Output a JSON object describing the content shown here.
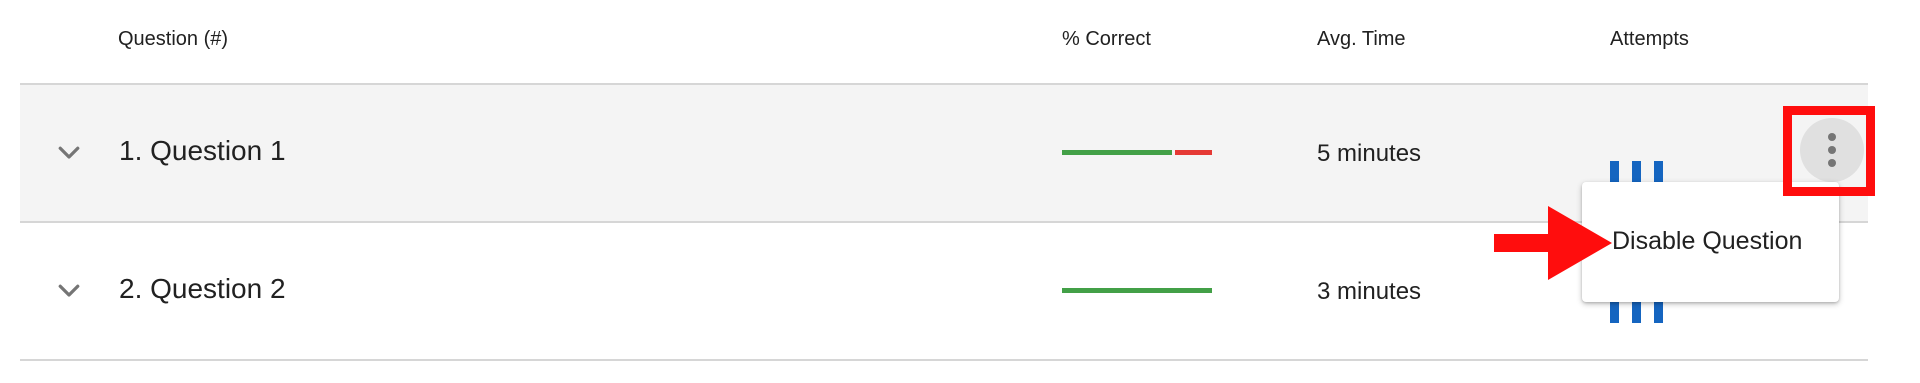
{
  "header": {
    "question_col": "Question (#)",
    "correct_col": "% Correct",
    "time_col": "Avg. Time",
    "attempts_col": "Attempts"
  },
  "rows": [
    {
      "title": "1. Question 1",
      "percent_correct": 0.75,
      "avg_time": "5 minutes",
      "expanded": false
    },
    {
      "title": "2. Question 2",
      "percent_correct": 1.0,
      "avg_time": "3 minutes",
      "expanded": false
    }
  ],
  "context_menu": {
    "items": [
      "Disable Question"
    ]
  },
  "colors": {
    "correct": "#43a047",
    "incorrect": "#e53935",
    "attempts": "#1565c0",
    "annotation": "#ff0d0d"
  },
  "icons": {
    "expand": "chevron-down-icon",
    "more": "more-vert-icon",
    "annotation_arrow": "arrow-right-icon"
  }
}
